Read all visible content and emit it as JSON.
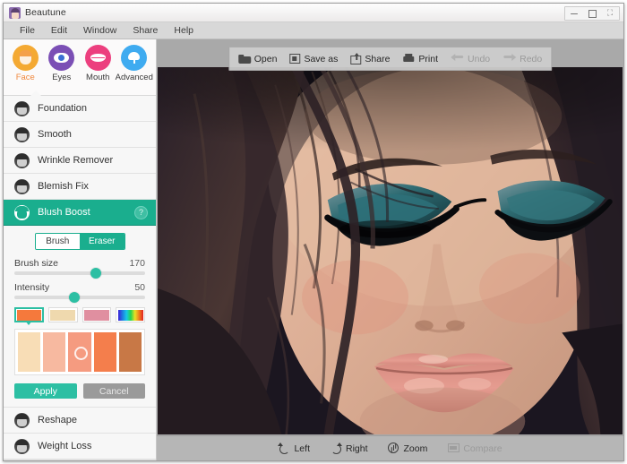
{
  "window": {
    "title": "Beautune",
    "app_icon": "beautune-app-icon",
    "controls": {
      "minimize": "–",
      "maximize": "□",
      "close": "✕"
    }
  },
  "menu": {
    "items": [
      {
        "label": "File"
      },
      {
        "label": "Edit"
      },
      {
        "label": "Window"
      },
      {
        "label": "Share"
      },
      {
        "label": "Help"
      }
    ]
  },
  "sidebar": {
    "category_tabs": [
      {
        "label": "Face",
        "icon": "face-icon",
        "color": "#f4a933",
        "active": true
      },
      {
        "label": "Eyes",
        "icon": "eye-icon",
        "color": "#7b4fb5",
        "active": false
      },
      {
        "label": "Mouth",
        "icon": "lips-icon",
        "color": "#ec3f7e",
        "active": false
      },
      {
        "label": "Advanced",
        "icon": "tulip-icon",
        "color": "#3fabf0",
        "active": false
      }
    ],
    "active_tab_label_color": "#f18a3f",
    "tools_top": [
      {
        "label": "Foundation",
        "icon": "foundation-icon",
        "active": false
      },
      {
        "label": "Smooth",
        "icon": "smooth-icon",
        "active": false
      },
      {
        "label": "Wrinkle Remover",
        "icon": "wrinkle-remover-icon",
        "active": false
      },
      {
        "label": "Blemish Fix",
        "icon": "blemish-fix-icon",
        "active": false
      },
      {
        "label": "Blush Boost",
        "icon": "blush-boost-icon",
        "active": true,
        "help": "?"
      }
    ],
    "tools_bottom": [
      {
        "label": "Reshape",
        "icon": "reshape-icon",
        "active": false
      },
      {
        "label": "Weight Loss",
        "icon": "weight-loss-icon",
        "active": false
      }
    ],
    "active_color": "#1aae8e"
  },
  "tool_panel": {
    "mode": {
      "brush_label": "Brush",
      "eraser_label": "Eraser",
      "selected": "Eraser"
    },
    "sliders": [
      {
        "name": "Brush size",
        "value": "170",
        "percent": 60
      },
      {
        "name": "Intensity",
        "value": "50",
        "percent": 45
      }
    ],
    "palette_top": [
      {
        "name": "orange-swatch",
        "color": "#f5793c",
        "selected": true
      },
      {
        "name": "beige-swatch",
        "color": "#efd9ae",
        "selected": false
      },
      {
        "name": "pink-swatch",
        "color": "#e08fa0",
        "selected": false
      },
      {
        "name": "rainbow-swatch",
        "color": "rainbow",
        "selected": false
      }
    ],
    "palette_shades": [
      {
        "name": "shade-1",
        "color": "#f8ddb6",
        "selected": false
      },
      {
        "name": "shade-2",
        "color": "#f7b9a0",
        "selected": false
      },
      {
        "name": "shade-3",
        "color": "#f59b80",
        "selected": true
      },
      {
        "name": "shade-4",
        "color": "#f47e4c",
        "selected": false
      },
      {
        "name": "shade-5",
        "color": "#c87846",
        "selected": false
      }
    ],
    "apply_label": "Apply",
    "cancel_label": "Cancel",
    "apply_color": "#2cbfa3",
    "cancel_color": "#9a9a9a"
  },
  "top_toolbar": {
    "items": [
      {
        "label": "Open",
        "icon": "folder-open-icon",
        "disabled": false
      },
      {
        "label": "Save as",
        "icon": "save-icon",
        "disabled": false
      },
      {
        "label": "Share",
        "icon": "share-icon",
        "disabled": false
      },
      {
        "label": "Print",
        "icon": "printer-icon",
        "disabled": false
      },
      {
        "label": "Undo",
        "icon": "undo-arrow-icon",
        "disabled": true
      },
      {
        "label": "Redo",
        "icon": "redo-arrow-icon",
        "disabled": true
      }
    ]
  },
  "bottom_toolbar": {
    "items": [
      {
        "label": "Left",
        "icon": "rotate-left-icon",
        "disabled": false
      },
      {
        "label": "Right",
        "icon": "rotate-right-icon",
        "disabled": false
      },
      {
        "label": "Zoom",
        "icon": "zoom-in-icon",
        "disabled": false
      },
      {
        "label": "Compare",
        "icon": "compare-icon",
        "disabled": true
      }
    ]
  },
  "canvas": {
    "photo_description": "portrait-photo-woman-teal-eye-makeup"
  }
}
